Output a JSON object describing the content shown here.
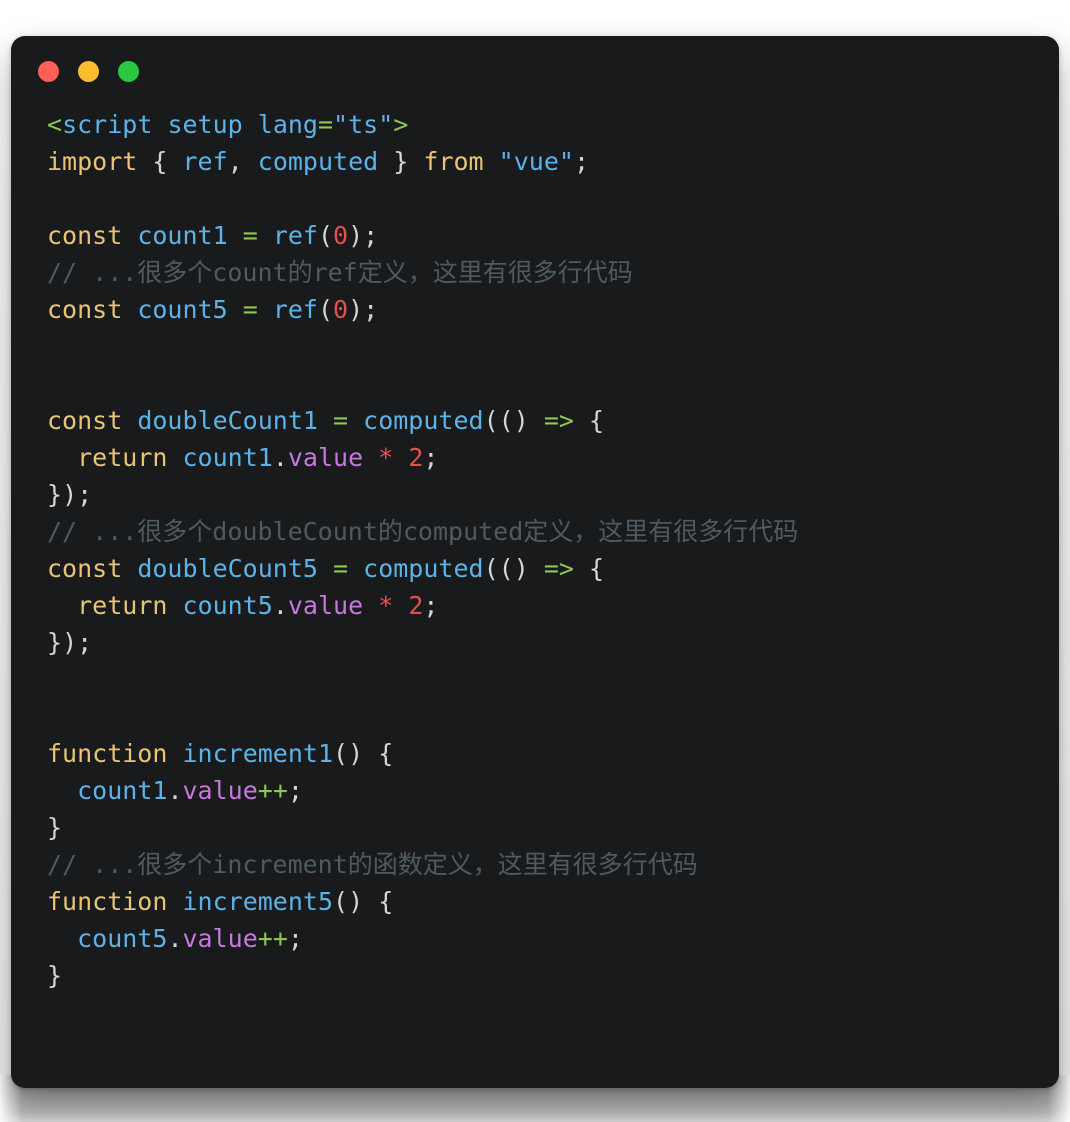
{
  "window": {
    "name": "code-snippet-window",
    "background_color": "#181a1b",
    "traffic_lights": [
      {
        "name": "close-dot",
        "label": "Close",
        "color": "#ff5f57"
      },
      {
        "name": "minimize-dot",
        "label": "Minimize",
        "color": "#ffbd2e"
      },
      {
        "name": "maximize-dot",
        "label": "Maximize",
        "color": "#28c840"
      }
    ]
  },
  "theme": {
    "keyword_color": "#e8c473",
    "identifier_color": "#5cb3e8",
    "string_color": "#5cb3e8",
    "operator_color": "#8fc653",
    "number_color": "#e35050",
    "property_color": "#c678dd",
    "punctuation_color": "#d4d4d4",
    "comment_color": "#4e5a62"
  },
  "code": {
    "language": "vue-ts",
    "lines": [
      "<script setup lang=\"ts\">",
      "import { ref, computed } from \"vue\";",
      "",
      "const count1 = ref(0);",
      "// ...很多个count的ref定义，这里有很多行代码",
      "const count5 = ref(0);",
      "",
      "",
      "const doubleCount1 = computed(() => {",
      "  return count1.value * 2;",
      "});",
      "// ...很多个doubleCount的computed定义，这里有很多行代码",
      "const doubleCount5 = computed(() => {",
      "  return count5.value * 2;",
      "});",
      "",
      "",
      "function increment1() {",
      "  count1.value++;",
      "}",
      "// ...很多个increment的函数定义，这里有很多行代码",
      "function increment5() {",
      "  count5.value++;",
      "}"
    ],
    "comments": [
      "// ...很多个count的ref定义，这里有很多行代码",
      "// ...很多个doubleCount的computed定义，这里有很多行代码",
      "// ...很多个increment的函数定义，这里有很多行代码"
    ],
    "identifiers": [
      "count1",
      "count5",
      "doubleCount1",
      "doubleCount5",
      "increment1",
      "increment5",
      "ref",
      "computed",
      "vue",
      "ts",
      "script",
      "setup",
      "lang",
      "value"
    ],
    "keywords": [
      "const",
      "import",
      "from",
      "return",
      "function"
    ],
    "numbers": [
      "0",
      "2"
    ]
  }
}
